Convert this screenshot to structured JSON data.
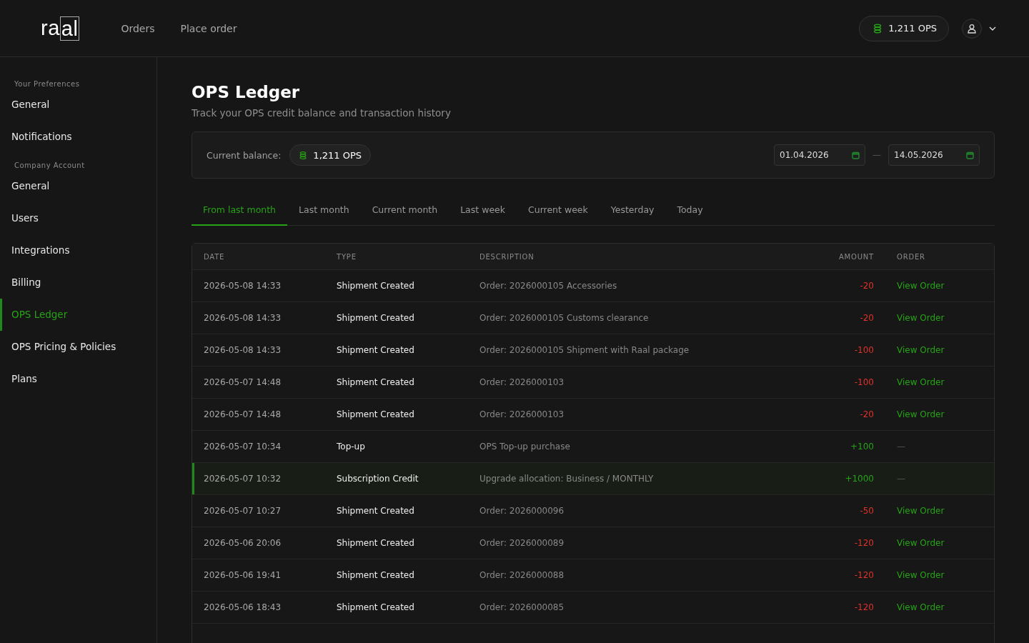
{
  "header": {
    "logo_plain": "ra",
    "logo_boxed": "al",
    "nav": [
      {
        "label": "Orders"
      },
      {
        "label": "Place order"
      }
    ],
    "balance": "1,211 OPS"
  },
  "sidebar": {
    "sections": [
      {
        "title": "Your Preferences",
        "items": [
          {
            "label": "General",
            "selected": false
          },
          {
            "label": "Notifications",
            "selected": false
          }
        ]
      },
      {
        "title": "Company Account",
        "items": [
          {
            "label": "General",
            "selected": false
          },
          {
            "label": "Users",
            "selected": false
          },
          {
            "label": "Integrations",
            "selected": false
          },
          {
            "label": "Billing",
            "selected": false
          },
          {
            "label": "OPS Ledger",
            "selected": true
          },
          {
            "label": "OPS Pricing & Policies",
            "selected": false
          },
          {
            "label": "Plans",
            "selected": false
          }
        ]
      }
    ]
  },
  "page": {
    "title": "OPS Ledger",
    "subtitle": "Track your OPS credit balance and transaction history"
  },
  "balance_card": {
    "label": "Current balance:",
    "value": "1,211 OPS",
    "date_from": "01.04.2026",
    "date_to": "14.05.2026",
    "separator": "—"
  },
  "tabs": [
    {
      "label": "From last month",
      "selected": true
    },
    {
      "label": "Last month",
      "selected": false
    },
    {
      "label": "Current month",
      "selected": false
    },
    {
      "label": "Last week",
      "selected": false
    },
    {
      "label": "Current week",
      "selected": false
    },
    {
      "label": "Yesterday",
      "selected": false
    },
    {
      "label": "Today",
      "selected": false
    }
  ],
  "table": {
    "columns": [
      "DATE",
      "TYPE",
      "DESCRIPTION",
      "AMOUNT",
      "ORDER"
    ],
    "rows": [
      {
        "date": "2026-05-08 14:33",
        "type": "Shipment Created",
        "description": "Order: 2026000105 Accessories",
        "amount": "-20",
        "kind": "debit",
        "order": "View Order",
        "selected": false
      },
      {
        "date": "2026-05-08 14:33",
        "type": "Shipment Created",
        "description": "Order: 2026000105 Customs clearance",
        "amount": "-20",
        "kind": "debit",
        "order": "View Order",
        "selected": false
      },
      {
        "date": "2026-05-08 14:33",
        "type": "Shipment Created",
        "description": "Order: 2026000105 Shipment with Raal package",
        "amount": "-100",
        "kind": "debit",
        "order": "View Order",
        "selected": false
      },
      {
        "date": "2026-05-07 14:48",
        "type": "Shipment Created",
        "description": "Order: 2026000103",
        "amount": "-100",
        "kind": "debit",
        "order": "View Order",
        "selected": false
      },
      {
        "date": "2026-05-07 14:48",
        "type": "Shipment Created",
        "description": "Order: 2026000103",
        "amount": "-20",
        "kind": "debit",
        "order": "View Order",
        "selected": false
      },
      {
        "date": "2026-05-07 10:34",
        "type": "Top-up",
        "description": "OPS Top-up purchase",
        "amount": "+100",
        "kind": "credit",
        "order": "—",
        "selected": false
      },
      {
        "date": "2026-05-07 10:32",
        "type": "Subscription Credit",
        "description": "Upgrade allocation: Business / MONTHLY",
        "amount": "+1000",
        "kind": "credit",
        "order": "—",
        "selected": true
      },
      {
        "date": "2026-05-07 10:27",
        "type": "Shipment Created",
        "description": "Order: 2026000096",
        "amount": "-50",
        "kind": "debit",
        "order": "View Order",
        "selected": false
      },
      {
        "date": "2026-05-06 20:06",
        "type": "Shipment Created",
        "description": "Order: 2026000089",
        "amount": "-120",
        "kind": "debit",
        "order": "View Order",
        "selected": false
      },
      {
        "date": "2026-05-06 19:41",
        "type": "Shipment Created",
        "description": "Order: 2026000088",
        "amount": "-120",
        "kind": "debit",
        "order": "View Order",
        "selected": false
      },
      {
        "date": "2026-05-06 18:43",
        "type": "Shipment Created",
        "description": "Order: 2026000085",
        "amount": "-120",
        "kind": "debit",
        "order": "View Order",
        "selected": false
      }
    ]
  }
}
